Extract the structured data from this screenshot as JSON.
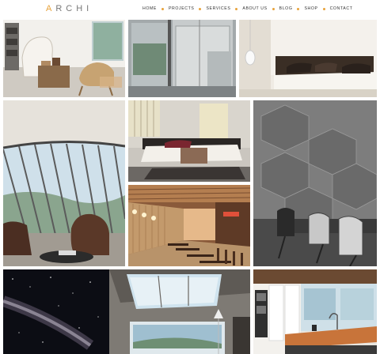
{
  "brand": {
    "logo_accent": "A",
    "logo_rest": "RCHI",
    "accent_color": "#e8a23a"
  },
  "nav": {
    "items": [
      {
        "label": "HOME"
      },
      {
        "label": "PROJECTS"
      },
      {
        "label": "SERVICES"
      },
      {
        "label": "ABOUT US"
      },
      {
        "label": "BLOG"
      },
      {
        "label": "SHOP"
      },
      {
        "label": "CONTACT"
      }
    ]
  },
  "gallery": {
    "tiles": [
      {
        "name": "living-room-armchairs"
      },
      {
        "name": "glass-shower-room"
      },
      {
        "name": "minimalist-bedroom"
      },
      {
        "name": "curved-glass-lounge"
      },
      {
        "name": "modern-bedroom"
      },
      {
        "name": "geometric-wall-office"
      },
      {
        "name": "wood-panel-restaurant"
      },
      {
        "name": "galaxy-skylight-room"
      },
      {
        "name": "skylight-interior"
      },
      {
        "name": "modern-kitchen"
      }
    ]
  }
}
